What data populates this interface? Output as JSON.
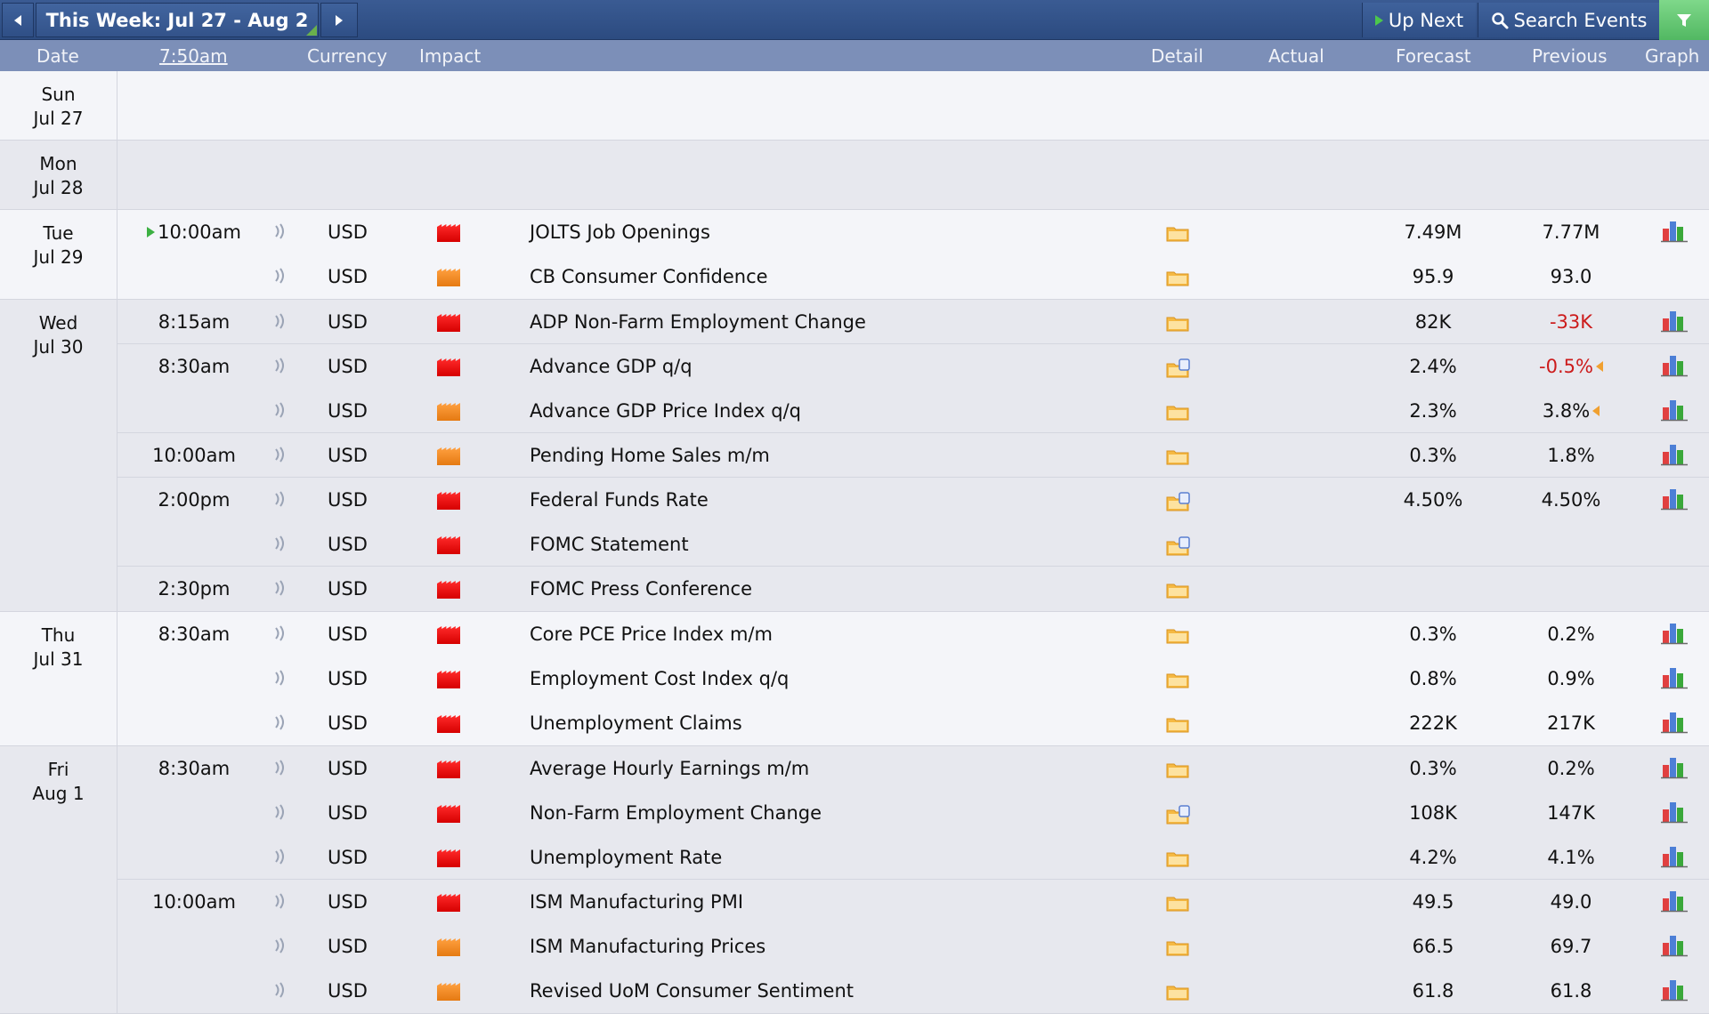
{
  "toolbar": {
    "week_label": "This Week: Jul 27 - Aug 2",
    "up_next": "Up Next",
    "search_events": "Search Events"
  },
  "header": {
    "date": "Date",
    "time": "7:50am",
    "currency": "Currency",
    "impact": "Impact",
    "detail": "Detail",
    "actual": "Actual",
    "forecast": "Forecast",
    "previous": "Previous",
    "graph": "Graph"
  },
  "days": [
    {
      "dow": "Sun",
      "date": "Jul 27"
    },
    {
      "dow": "Mon",
      "date": "Jul 28"
    },
    {
      "dow": "Tue",
      "date": "Jul 29"
    },
    {
      "dow": "Wed",
      "date": "Jul 30"
    },
    {
      "dow": "Thu",
      "date": "Jul 31"
    },
    {
      "dow": "Fri",
      "date": "Aug 1"
    }
  ],
  "events": [
    {
      "time": "10:00am",
      "currency": "USD",
      "impact": "high",
      "name": "JOLTS Job Openings",
      "detail_icon": "folder-icon",
      "actual": "",
      "forecast": "7.49M",
      "previous": "7.77M",
      "graph": true
    },
    {
      "time": "",
      "currency": "USD",
      "impact": "medium",
      "name": "CB Consumer Confidence",
      "detail_icon": "folder-icon",
      "actual": "",
      "forecast": "95.9",
      "previous": "93.0",
      "graph": false
    },
    {
      "time": "8:15am",
      "currency": "USD",
      "impact": "high",
      "name": "ADP Non-Farm Employment Change",
      "detail_icon": "folder-icon",
      "actual": "",
      "forecast": "82K",
      "previous": "-33K",
      "graph": true
    },
    {
      "time": "8:30am",
      "currency": "USD",
      "impact": "high",
      "name": "Advance GDP q/q",
      "detail_icon": "folder-doc-icon",
      "actual": "",
      "forecast": "2.4%",
      "previous": "-0.5%",
      "graph": true
    },
    {
      "time": "",
      "currency": "USD",
      "impact": "medium",
      "name": "Advance GDP Price Index q/q",
      "detail_icon": "folder-icon",
      "actual": "",
      "forecast": "2.3%",
      "previous": "3.8%",
      "graph": true
    },
    {
      "time": "10:00am",
      "currency": "USD",
      "impact": "medium",
      "name": "Pending Home Sales m/m",
      "detail_icon": "folder-icon",
      "actual": "",
      "forecast": "0.3%",
      "previous": "1.8%",
      "graph": true
    },
    {
      "time": "2:00pm",
      "currency": "USD",
      "impact": "high",
      "name": "Federal Funds Rate",
      "detail_icon": "folder-doc-icon",
      "actual": "",
      "forecast": "4.50%",
      "previous": "4.50%",
      "graph": true
    },
    {
      "time": "",
      "currency": "USD",
      "impact": "high",
      "name": "FOMC Statement",
      "detail_icon": "folder-doc-icon",
      "actual": "",
      "forecast": "",
      "previous": "",
      "graph": false
    },
    {
      "time": "2:30pm",
      "currency": "USD",
      "impact": "high",
      "name": "FOMC Press Conference",
      "detail_icon": "folder-icon",
      "actual": "",
      "forecast": "",
      "previous": "",
      "graph": false
    },
    {
      "time": "8:30am",
      "currency": "USD",
      "impact": "high",
      "name": "Core PCE Price Index m/m",
      "detail_icon": "folder-icon",
      "actual": "",
      "forecast": "0.3%",
      "previous": "0.2%",
      "graph": true
    },
    {
      "time": "",
      "currency": "USD",
      "impact": "high",
      "name": "Employment Cost Index q/q",
      "detail_icon": "folder-icon",
      "actual": "",
      "forecast": "0.8%",
      "previous": "0.9%",
      "graph": true
    },
    {
      "time": "",
      "currency": "USD",
      "impact": "high",
      "name": "Unemployment Claims",
      "detail_icon": "folder-icon",
      "actual": "",
      "forecast": "222K",
      "previous": "217K",
      "graph": true
    },
    {
      "time": "8:30am",
      "currency": "USD",
      "impact": "high",
      "name": "Average Hourly Earnings m/m",
      "detail_icon": "folder-icon",
      "actual": "",
      "forecast": "0.3%",
      "previous": "0.2%",
      "graph": true
    },
    {
      "time": "",
      "currency": "USD",
      "impact": "high",
      "name": "Non-Farm Employment Change",
      "detail_icon": "folder-doc-icon",
      "actual": "",
      "forecast": "108K",
      "previous": "147K",
      "graph": true
    },
    {
      "time": "",
      "currency": "USD",
      "impact": "high",
      "name": "Unemployment Rate",
      "detail_icon": "folder-icon",
      "actual": "",
      "forecast": "4.2%",
      "previous": "4.1%",
      "graph": true
    },
    {
      "time": "10:00am",
      "currency": "USD",
      "impact": "high",
      "name": "ISM Manufacturing PMI",
      "detail_icon": "folder-icon",
      "actual": "",
      "forecast": "49.5",
      "previous": "49.0",
      "graph": true
    },
    {
      "time": "",
      "currency": "USD",
      "impact": "medium",
      "name": "ISM Manufacturing Prices",
      "detail_icon": "folder-icon",
      "actual": "",
      "forecast": "66.5",
      "previous": "69.7",
      "graph": true
    },
    {
      "time": "",
      "currency": "USD",
      "impact": "medium",
      "name": "Revised UoM Consumer Sentiment",
      "detail_icon": "folder-icon",
      "actual": "",
      "forecast": "61.8",
      "previous": "61.8",
      "graph": true
    }
  ],
  "colors": {
    "impact_high": "#e00000",
    "impact_medium": "#f08a24",
    "previous_worse": "#cc1b1b",
    "header_bg": "#7c8fb8",
    "toolbar_bg": "#2c4b80"
  }
}
